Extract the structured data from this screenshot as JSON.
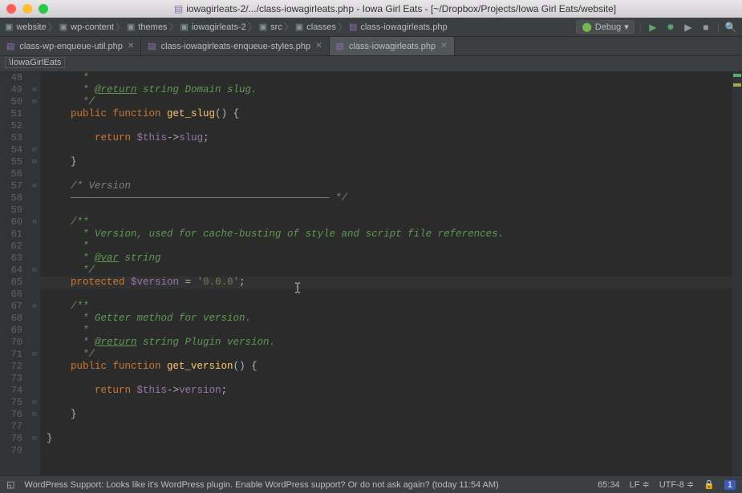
{
  "window": {
    "title": "iowagirleats-2/.../class-iowagirleats.php - Iowa Girl Eats - [~/Dropbox/Projects/Iowa Girl Eats/website]"
  },
  "crumbs": [
    "website",
    "wp-content",
    "themes",
    "iowagirleats-2",
    "src",
    "classes",
    "class-iowagirleats.php"
  ],
  "debug_label": "Debug",
  "tabs": [
    {
      "label": "class-wp-enqueue-util.php",
      "active": false
    },
    {
      "label": "class-iowagirleats-enqueue-styles.php",
      "active": false
    },
    {
      "label": "class-iowagirleats.php",
      "active": true
    }
  ],
  "bc": "\\IowaGirlEats",
  "lines": {
    "start": 48,
    "end": 79
  },
  "folds": {
    "49": "⊖",
    "50": "⊟",
    "54": "⊟",
    "55": "⊟",
    "57": "⊖",
    "60": "⊖",
    "64": "⊟",
    "67": "⊖",
    "71": "⊟",
    "75": "⊟",
    "76": "⊟",
    "78": "⊟"
  },
  "code": {
    "48": [
      {
        "c": "c-doc",
        "t": "      *"
      }
    ],
    "49": [
      {
        "c": "c-doc",
        "t": "      * "
      },
      {
        "c": "c-tag",
        "t": "@return"
      },
      {
        "c": "c-doc",
        "t": " string Domain slug."
      }
    ],
    "50": [
      {
        "c": "c-doc",
        "t": "      */"
      }
    ],
    "51": [
      {
        "c": "c-pl",
        "t": "    "
      },
      {
        "c": "c-kw",
        "t": "public function "
      },
      {
        "c": "c-fn",
        "t": "get_slug"
      },
      {
        "c": "c-pl",
        "t": "() {"
      }
    ],
    "52": [
      {
        "c": "c-pl",
        "t": ""
      }
    ],
    "53": [
      {
        "c": "c-pl",
        "t": "        "
      },
      {
        "c": "c-kw",
        "t": "return "
      },
      {
        "c": "c-var",
        "t": "$this"
      },
      {
        "c": "c-pl",
        "t": "->"
      },
      {
        "c": "c-var",
        "t": "slug"
      },
      {
        "c": "c-pl",
        "t": ";"
      }
    ],
    "54": [
      {
        "c": "c-pl",
        "t": ""
      }
    ],
    "55": [
      {
        "c": "c-pl",
        "t": "    }"
      }
    ],
    "56": [
      {
        "c": "c-pl",
        "t": ""
      }
    ],
    "57": [
      {
        "c": "c-com",
        "t": "    /* Version"
      }
    ],
    "58": [
      {
        "c": "c-com",
        "t": "    ——————————————————————————————————————————— */"
      }
    ],
    "59": [
      {
        "c": "c-pl",
        "t": ""
      }
    ],
    "60": [
      {
        "c": "c-doc",
        "t": "    /**"
      }
    ],
    "61": [
      {
        "c": "c-doc",
        "t": "      * Version, used for cache-busting of style and script file references."
      }
    ],
    "62": [
      {
        "c": "c-doc",
        "t": "      *"
      }
    ],
    "63": [
      {
        "c": "c-doc",
        "t": "      * "
      },
      {
        "c": "c-tag",
        "t": "@var"
      },
      {
        "c": "c-doc",
        "t": " string"
      }
    ],
    "64": [
      {
        "c": "c-doc",
        "t": "      */"
      }
    ],
    "65": [
      {
        "c": "c-pl",
        "t": "    "
      },
      {
        "c": "c-kw",
        "t": "protected "
      },
      {
        "c": "c-var",
        "t": "$version"
      },
      {
        "c": "c-pl",
        "t": " = "
      },
      {
        "c": "c-str",
        "t": "'0.0.0'"
      },
      {
        "c": "c-pl",
        "t": ";"
      }
    ],
    "66": [
      {
        "c": "c-pl",
        "t": ""
      }
    ],
    "67": [
      {
        "c": "c-doc",
        "t": "    /**"
      }
    ],
    "68": [
      {
        "c": "c-doc",
        "t": "      * Getter method for version."
      }
    ],
    "69": [
      {
        "c": "c-doc",
        "t": "      *"
      }
    ],
    "70": [
      {
        "c": "c-doc",
        "t": "      * "
      },
      {
        "c": "c-tag",
        "t": "@return"
      },
      {
        "c": "c-doc",
        "t": " string Plugin version."
      }
    ],
    "71": [
      {
        "c": "c-doc",
        "t": "      */"
      }
    ],
    "72": [
      {
        "c": "c-pl",
        "t": "    "
      },
      {
        "c": "c-kw",
        "t": "public function "
      },
      {
        "c": "c-fn",
        "t": "get_version"
      },
      {
        "c": "c-pl",
        "t": "() {"
      }
    ],
    "73": [
      {
        "c": "c-pl",
        "t": ""
      }
    ],
    "74": [
      {
        "c": "c-pl",
        "t": "        "
      },
      {
        "c": "c-kw",
        "t": "return "
      },
      {
        "c": "c-var",
        "t": "$this"
      },
      {
        "c": "c-pl",
        "t": "->"
      },
      {
        "c": "c-var",
        "t": "version"
      },
      {
        "c": "c-pl",
        "t": ";"
      }
    ],
    "75": [
      {
        "c": "c-pl",
        "t": ""
      }
    ],
    "76": [
      {
        "c": "c-pl",
        "t": "    }"
      }
    ],
    "77": [
      {
        "c": "c-pl",
        "t": ""
      }
    ],
    "78": [
      {
        "c": "c-pl",
        "t": "}"
      }
    ],
    "79": [
      {
        "c": "c-pl",
        "t": ""
      }
    ]
  },
  "highlight_line": 65,
  "status": {
    "msg": "WordPress Support: Looks like it's WordPress plugin. Enable WordPress support? Or do not ask again? (today 11:54 AM)",
    "pos": "65:34",
    "sep": "LF",
    "enc": "UTF-8",
    "lock": "🔒",
    "badge": "1"
  }
}
